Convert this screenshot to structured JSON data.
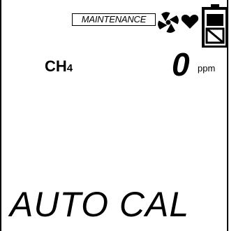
{
  "status_bar": {
    "mode_badge": "MAINTENANCE",
    "icons": [
      "fan-icon",
      "heart-icon",
      "battery-icon"
    ]
  },
  "gas": {
    "name": "CH",
    "subscript": "4",
    "reading": "0",
    "unit": "ppm"
  },
  "status": {
    "text": "AUTO CAL"
  },
  "colors": {
    "foreground": "#000000",
    "background": "#ffffff"
  }
}
